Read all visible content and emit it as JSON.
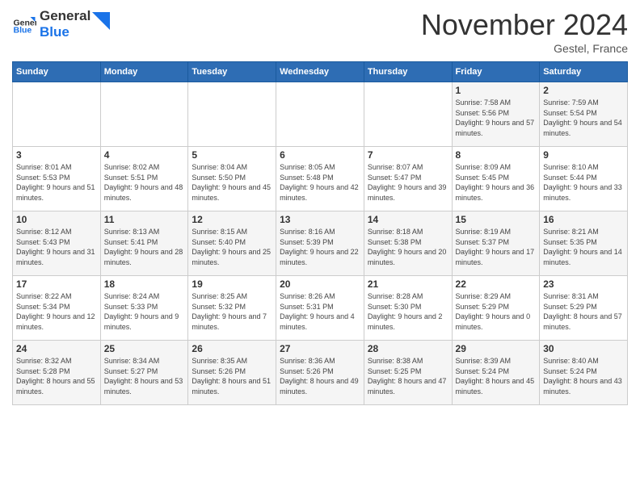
{
  "header": {
    "logo_general": "General",
    "logo_blue": "Blue",
    "month_title": "November 2024",
    "location": "Gestel, France"
  },
  "weekdays": [
    "Sunday",
    "Monday",
    "Tuesday",
    "Wednesday",
    "Thursday",
    "Friday",
    "Saturday"
  ],
  "weeks": [
    [
      {
        "day": "",
        "info": ""
      },
      {
        "day": "",
        "info": ""
      },
      {
        "day": "",
        "info": ""
      },
      {
        "day": "",
        "info": ""
      },
      {
        "day": "",
        "info": ""
      },
      {
        "day": "1",
        "info": "Sunrise: 7:58 AM\nSunset: 5:56 PM\nDaylight: 9 hours and 57 minutes."
      },
      {
        "day": "2",
        "info": "Sunrise: 7:59 AM\nSunset: 5:54 PM\nDaylight: 9 hours and 54 minutes."
      }
    ],
    [
      {
        "day": "3",
        "info": "Sunrise: 8:01 AM\nSunset: 5:53 PM\nDaylight: 9 hours and 51 minutes."
      },
      {
        "day": "4",
        "info": "Sunrise: 8:02 AM\nSunset: 5:51 PM\nDaylight: 9 hours and 48 minutes."
      },
      {
        "day": "5",
        "info": "Sunrise: 8:04 AM\nSunset: 5:50 PM\nDaylight: 9 hours and 45 minutes."
      },
      {
        "day": "6",
        "info": "Sunrise: 8:05 AM\nSunset: 5:48 PM\nDaylight: 9 hours and 42 minutes."
      },
      {
        "day": "7",
        "info": "Sunrise: 8:07 AM\nSunset: 5:47 PM\nDaylight: 9 hours and 39 minutes."
      },
      {
        "day": "8",
        "info": "Sunrise: 8:09 AM\nSunset: 5:45 PM\nDaylight: 9 hours and 36 minutes."
      },
      {
        "day": "9",
        "info": "Sunrise: 8:10 AM\nSunset: 5:44 PM\nDaylight: 9 hours and 33 minutes."
      }
    ],
    [
      {
        "day": "10",
        "info": "Sunrise: 8:12 AM\nSunset: 5:43 PM\nDaylight: 9 hours and 31 minutes."
      },
      {
        "day": "11",
        "info": "Sunrise: 8:13 AM\nSunset: 5:41 PM\nDaylight: 9 hours and 28 minutes."
      },
      {
        "day": "12",
        "info": "Sunrise: 8:15 AM\nSunset: 5:40 PM\nDaylight: 9 hours and 25 minutes."
      },
      {
        "day": "13",
        "info": "Sunrise: 8:16 AM\nSunset: 5:39 PM\nDaylight: 9 hours and 22 minutes."
      },
      {
        "day": "14",
        "info": "Sunrise: 8:18 AM\nSunset: 5:38 PM\nDaylight: 9 hours and 20 minutes."
      },
      {
        "day": "15",
        "info": "Sunrise: 8:19 AM\nSunset: 5:37 PM\nDaylight: 9 hours and 17 minutes."
      },
      {
        "day": "16",
        "info": "Sunrise: 8:21 AM\nSunset: 5:35 PM\nDaylight: 9 hours and 14 minutes."
      }
    ],
    [
      {
        "day": "17",
        "info": "Sunrise: 8:22 AM\nSunset: 5:34 PM\nDaylight: 9 hours and 12 minutes."
      },
      {
        "day": "18",
        "info": "Sunrise: 8:24 AM\nSunset: 5:33 PM\nDaylight: 9 hours and 9 minutes."
      },
      {
        "day": "19",
        "info": "Sunrise: 8:25 AM\nSunset: 5:32 PM\nDaylight: 9 hours and 7 minutes."
      },
      {
        "day": "20",
        "info": "Sunrise: 8:26 AM\nSunset: 5:31 PM\nDaylight: 9 hours and 4 minutes."
      },
      {
        "day": "21",
        "info": "Sunrise: 8:28 AM\nSunset: 5:30 PM\nDaylight: 9 hours and 2 minutes."
      },
      {
        "day": "22",
        "info": "Sunrise: 8:29 AM\nSunset: 5:29 PM\nDaylight: 9 hours and 0 minutes."
      },
      {
        "day": "23",
        "info": "Sunrise: 8:31 AM\nSunset: 5:29 PM\nDaylight: 8 hours and 57 minutes."
      }
    ],
    [
      {
        "day": "24",
        "info": "Sunrise: 8:32 AM\nSunset: 5:28 PM\nDaylight: 8 hours and 55 minutes."
      },
      {
        "day": "25",
        "info": "Sunrise: 8:34 AM\nSunset: 5:27 PM\nDaylight: 8 hours and 53 minutes."
      },
      {
        "day": "26",
        "info": "Sunrise: 8:35 AM\nSunset: 5:26 PM\nDaylight: 8 hours and 51 minutes."
      },
      {
        "day": "27",
        "info": "Sunrise: 8:36 AM\nSunset: 5:26 PM\nDaylight: 8 hours and 49 minutes."
      },
      {
        "day": "28",
        "info": "Sunrise: 8:38 AM\nSunset: 5:25 PM\nDaylight: 8 hours and 47 minutes."
      },
      {
        "day": "29",
        "info": "Sunrise: 8:39 AM\nSunset: 5:24 PM\nDaylight: 8 hours and 45 minutes."
      },
      {
        "day": "30",
        "info": "Sunrise: 8:40 AM\nSunset: 5:24 PM\nDaylight: 8 hours and 43 minutes."
      }
    ]
  ]
}
